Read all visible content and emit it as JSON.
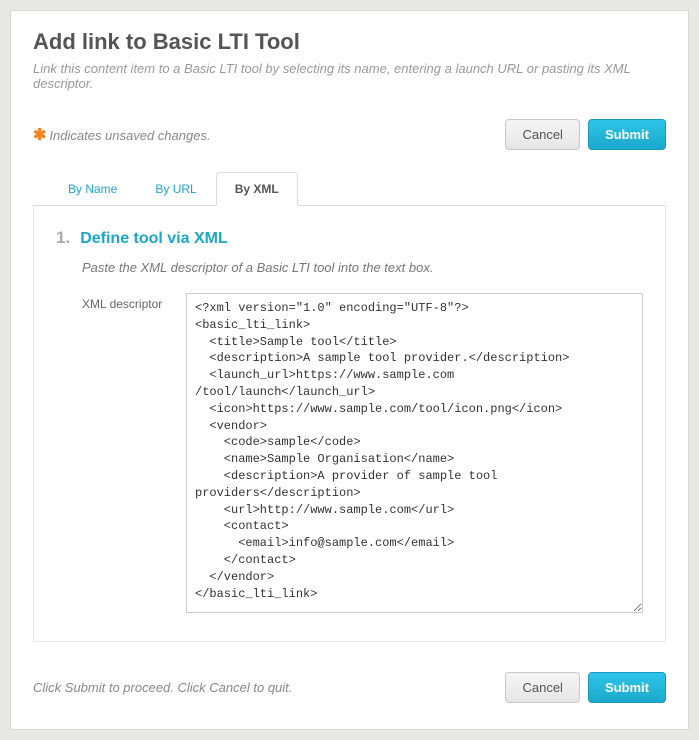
{
  "header": {
    "title": "Add link to Basic LTI Tool",
    "subtitle": "Link this content item to a Basic LTI tool by selecting its name, entering a launch URL or pasting its XML descriptor."
  },
  "unsaved_notice": "Indicates unsaved changes.",
  "buttons": {
    "cancel": "Cancel",
    "submit": "Submit"
  },
  "tabs": {
    "by_name": "By Name",
    "by_url": "By URL",
    "by_xml": "By XML"
  },
  "step": {
    "number": "1.",
    "title": "Define tool via XML",
    "description": "Paste the XML descriptor of a Basic LTI tool into the text box."
  },
  "form": {
    "label": "XML descriptor",
    "xml_value": "<?xml version=\"1.0\" encoding=\"UTF-8\"?>\n<basic_lti_link>\n  <title>Sample tool</title>\n  <description>A sample tool provider.</description>\n  <launch_url>https://www.sample.com\n/tool/launch</launch_url>\n  <icon>https://www.sample.com/tool/icon.png</icon>\n  <vendor>\n    <code>sample</code>\n    <name>Sample Organisation</name>\n    <description>A provider of sample tool\nproviders</description>\n    <url>http://www.sample.com</url>\n    <contact>\n      <email>info@sample.com</email>\n    </contact>\n  </vendor>\n</basic_lti_link>"
  },
  "footer": {
    "text": "Click Submit to proceed. Click Cancel to quit."
  }
}
